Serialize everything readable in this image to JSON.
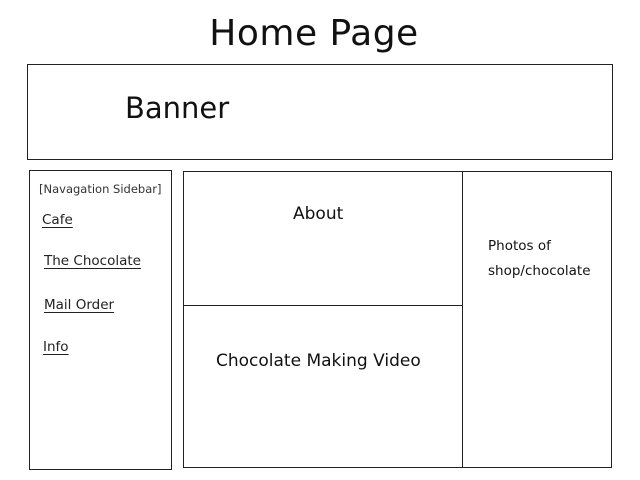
{
  "page": {
    "title": "Home Page"
  },
  "banner": {
    "label": "Banner"
  },
  "sidebar": {
    "title": "[Navagation Sidebar]",
    "items": [
      {
        "label": "Cafe"
      },
      {
        "label": "The Chocolate"
      },
      {
        "label": "Mail Order"
      },
      {
        "label": "Info"
      }
    ]
  },
  "main": {
    "about_label": "About",
    "video_label": "Chocolate Making Video"
  },
  "photos": {
    "line1": "Photos of",
    "line2": "shop/chocolate"
  }
}
